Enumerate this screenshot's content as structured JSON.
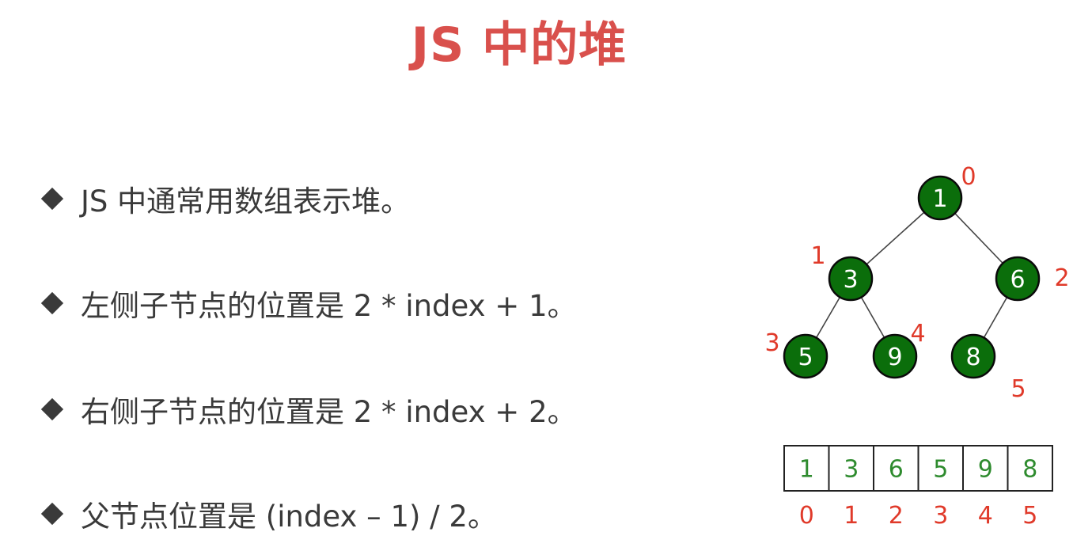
{
  "title": "JS 中的堆",
  "bullets": [
    "JS 中通常用数组表示堆。",
    "左侧子节点的位置是 2 * index + 1。",
    "右侧子节点的位置是 2 * index + 2。",
    "父节点位置是 (index – 1) / 2。"
  ],
  "heap": {
    "values": [
      "1",
      "3",
      "6",
      "5",
      "9",
      "8"
    ],
    "indices": [
      "0",
      "1",
      "2",
      "3",
      "4",
      "5"
    ],
    "node_color": "#0b6e0b",
    "index_color": "#e03a2a",
    "cell_text_color": "#2e8b2e"
  }
}
